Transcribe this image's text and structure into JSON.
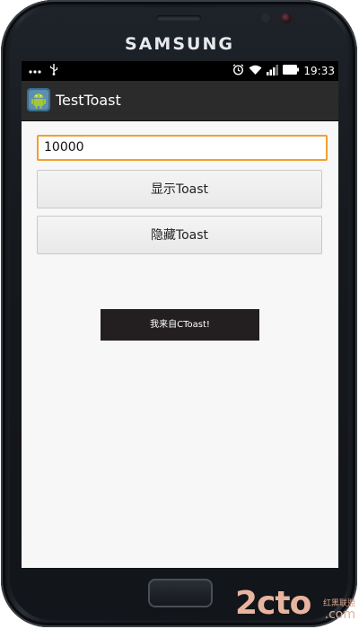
{
  "device": {
    "brand": "SAMSUNG"
  },
  "status_bar": {
    "icons_left": [
      "more-dots-icon",
      "usb-icon"
    ],
    "icons_right": [
      "alarm-icon",
      "wifi-icon",
      "signal-icon",
      "battery-icon"
    ],
    "time": "19:33"
  },
  "app_bar": {
    "icon": "android-icon",
    "title": "TestToast"
  },
  "form": {
    "input_value": "10000",
    "show_button_label": "显示Toast",
    "hide_button_label": "隐藏Toast"
  },
  "toast": {
    "message": "我来自CToast!"
  },
  "watermark": {
    "main": "2cto",
    "sub": "红黑联盟",
    "domain": ".com"
  },
  "colors": {
    "input_focus_border": "#f0a030",
    "toast_background": "#231f20",
    "title_bar_background": "#2b2b2b"
  }
}
